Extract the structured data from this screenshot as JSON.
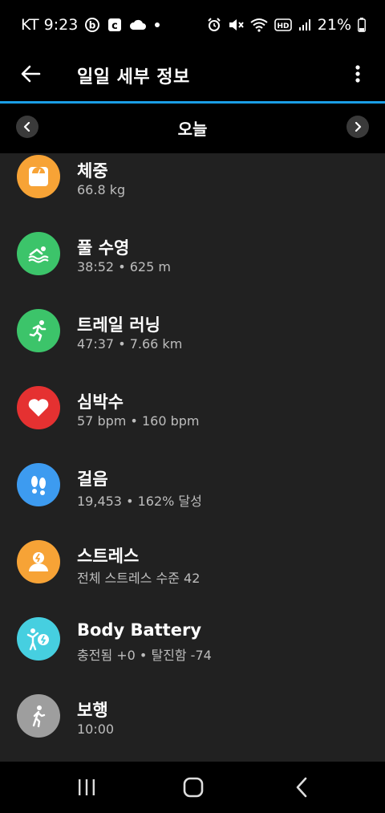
{
  "status_bar": {
    "carrier_time": "KT 9:23",
    "battery": "21%",
    "icons": [
      "b-circle-icon",
      "c-square-icon",
      "cloud-icon",
      "dot-icon",
      "alarm-icon",
      "mute-icon",
      "wifi-icon",
      "hd-icon",
      "signal-icon",
      "battery-icon"
    ]
  },
  "app_bar": {
    "title": "일일 세부 정보"
  },
  "date_nav": {
    "label": "오늘"
  },
  "items": [
    {
      "title": "체중",
      "subtitle": "66.8 kg",
      "icon": "scale-icon",
      "color": "#f7a336"
    },
    {
      "title": "풀 수영",
      "subtitle": "38:52 • 625 m",
      "icon": "swim-icon",
      "color": "#3cc46a"
    },
    {
      "title": "트레일 러닝",
      "subtitle": "47:37 • 7.66 km",
      "icon": "run-icon",
      "color": "#3cc46a"
    },
    {
      "title": "심박수",
      "subtitle": "57 bpm • 160 bpm",
      "icon": "heart-icon",
      "color": "#e53131"
    },
    {
      "title": "걸음",
      "subtitle": "19,453 • 162% 달성",
      "icon": "footsteps-icon",
      "color": "#3d9bf0"
    },
    {
      "title": "스트레스",
      "subtitle": "전체 스트레스 수준 42",
      "icon": "stress-icon",
      "color": "#f7a336"
    },
    {
      "title": "Body Battery",
      "subtitle": "충전됨 +0 • 탈진함 -74",
      "icon": "body-battery-icon",
      "color": "#46cfe0"
    },
    {
      "title": "보행",
      "subtitle": "10:00",
      "icon": "walk-icon",
      "color": "#9e9e9e"
    }
  ]
}
